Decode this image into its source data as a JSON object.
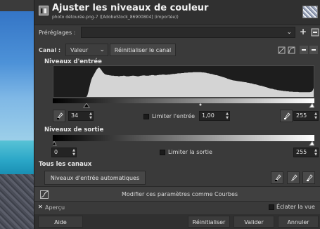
{
  "window": {
    "title": "Ajuster les niveaux de couleur",
    "subtitle": "photo détourée.png-7 ([AdobeStock_86900804] (importée))"
  },
  "presets": {
    "label": "Préréglages :",
    "value": ""
  },
  "channel": {
    "label": "Canal :",
    "value": "Valeur",
    "reset_label": "Réinitialiser le canal"
  },
  "input_levels": {
    "title": "Niveaux d'entrée",
    "low": "34",
    "gamma": "1,00",
    "high": "255",
    "clamp_label": "Limiter l'entrée",
    "clamp_checked": false
  },
  "output_levels": {
    "title": "Niveaux de sortie",
    "low": "0",
    "high": "255",
    "clamp_label": "Limiter la sortie",
    "clamp_checked": false
  },
  "all_channels": {
    "title": "Tous les canaux",
    "auto_label": "Niveaux d'entrée automatiques"
  },
  "curves": {
    "label": "Modifier ces paramètres comme Courbes"
  },
  "preview": {
    "label": "Aperçu",
    "checked": true
  },
  "split_view": {
    "label": "Éclater la vue",
    "checked": false
  },
  "buttons": {
    "help": "Aide",
    "reset": "Réinitialiser",
    "ok": "Valider",
    "cancel": "Annuler"
  },
  "histogram": [
    0,
    0,
    0,
    0,
    0,
    0,
    0,
    0,
    0,
    0,
    0,
    0,
    0,
    0,
    0,
    0,
    0,
    0,
    0,
    0,
    0,
    0,
    0,
    0,
    0,
    0,
    0,
    0,
    0,
    0,
    0,
    0,
    0,
    0,
    0,
    0.06,
    0.18,
    0.32,
    0.46,
    0.58,
    0.66,
    0.72,
    0.78,
    0.84,
    0.9,
    0.95,
    0.98,
    1.0,
    0.97,
    0.93,
    0.88,
    0.83,
    0.8,
    0.77,
    0.76,
    0.75,
    0.74,
    0.74,
    0.73,
    0.73,
    0.72,
    0.72,
    0.72,
    0.71,
    0.71,
    0.71,
    0.71,
    0.7,
    0.7,
    0.71,
    0.71,
    0.71,
    0.72,
    0.72,
    0.71,
    0.7,
    0.7,
    0.7,
    0.7,
    0.71,
    0.71,
    0.72,
    0.72,
    0.72,
    0.71,
    0.71,
    0.7,
    0.7,
    0.7,
    0.71,
    0.72,
    0.72,
    0.73,
    0.73,
    0.73,
    0.72,
    0.72,
    0.72,
    0.72,
    0.73,
    0.73,
    0.74,
    0.74,
    0.74,
    0.73,
    0.73,
    0.73,
    0.74,
    0.74,
    0.75,
    0.75,
    0.75,
    0.76,
    0.76,
    0.76,
    0.75,
    0.75,
    0.75,
    0.76,
    0.76,
    0.76,
    0.77,
    0.77,
    0.78,
    0.78,
    0.78,
    0.79,
    0.79,
    0.8,
    0.8,
    0.8,
    0.8,
    0.81,
    0.81,
    0.81,
    0.82,
    0.82,
    0.82,
    0.82,
    0.83,
    0.83,
    0.83,
    0.83,
    0.83,
    0.84,
    0.84,
    0.84,
    0.84,
    0.84,
    0.84,
    0.84,
    0.84,
    0.84,
    0.83,
    0.83,
    0.83,
    0.82,
    0.82,
    0.81,
    0.8,
    0.8,
    0.79,
    0.78,
    0.78,
    0.77,
    0.76,
    0.75,
    0.74,
    0.74,
    0.73,
    0.72,
    0.71,
    0.7,
    0.69,
    0.68,
    0.67,
    0.66,
    0.65,
    0.64,
    0.62,
    0.61,
    0.6,
    0.59,
    0.58,
    0.57,
    0.56,
    0.56,
    0.55,
    0.55,
    0.54,
    0.54,
    0.53,
    0.53,
    0.52,
    0.52,
    0.51,
    0.51,
    0.5,
    0.5,
    0.49,
    0.48,
    0.48,
    0.47,
    0.46,
    0.46,
    0.45,
    0.44,
    0.43,
    0.43,
    0.42,
    0.41,
    0.4,
    0.39,
    0.38,
    0.38,
    0.37,
    0.36,
    0.35,
    0.34,
    0.33,
    0.32,
    0.31,
    0.3,
    0.29,
    0.28,
    0.28,
    0.27,
    0.26,
    0.25,
    0.25,
    0.24,
    0.23,
    0.23,
    0.22,
    0.22,
    0.21,
    0.21,
    0.2,
    0.2,
    0.2,
    0.19,
    0.19,
    0.19,
    0.18,
    0.18,
    0.18,
    0.18,
    0.17,
    0.17,
    0.17,
    0.17,
    0.17,
    0.17,
    0.16,
    0.16,
    0.16,
    0.16,
    0.16,
    0.16,
    0.16,
    0.16,
    0.16,
    0.16,
    0.16,
    0.16,
    0.17,
    0.18,
    0.22,
    0.3
  ]
}
